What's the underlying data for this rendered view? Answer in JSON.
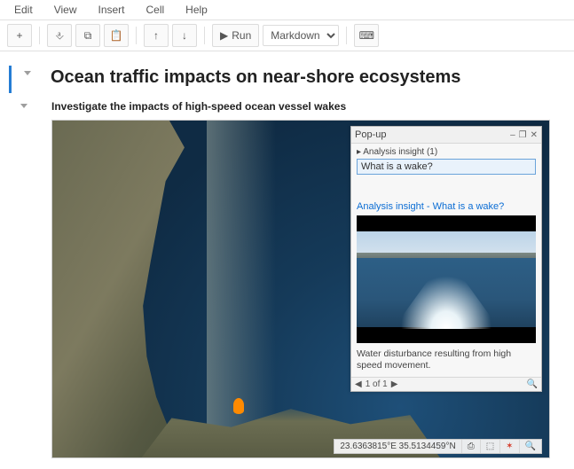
{
  "menu": {
    "edit": "Edit",
    "view": "View",
    "insert": "Insert",
    "cell": "Cell",
    "help": "Help"
  },
  "toolbar": {
    "run_label": "Run",
    "celltype_selected": "Markdown"
  },
  "notebook": {
    "title": "Ocean traffic impacts on near-shore ecosystems",
    "subheading": "Investigate the impacts of high-speed ocean vessel wakes"
  },
  "popup": {
    "title": "Pop-up",
    "insight_label": "Analysis insight  (1)",
    "question": "What is a wake?",
    "link_text": "Analysis insight - What is a wake?",
    "caption": "Water disturbance resulting from high speed movement.",
    "pager": "1 of 1"
  },
  "coords": "23.6363815°E 35.5134459°N",
  "icons": {
    "add": "+",
    "insert-below": "⎀",
    "copy": "⧉",
    "paste": "📋",
    "up": "↑",
    "down": "↓",
    "run": "▶",
    "keyboard": "⌨",
    "minimize": "–",
    "restore": "❐",
    "close": "✕",
    "prev": "◀",
    "next": "▶",
    "print": "⎙",
    "select": "⬚",
    "target": "✶",
    "zoom": "🔍"
  }
}
